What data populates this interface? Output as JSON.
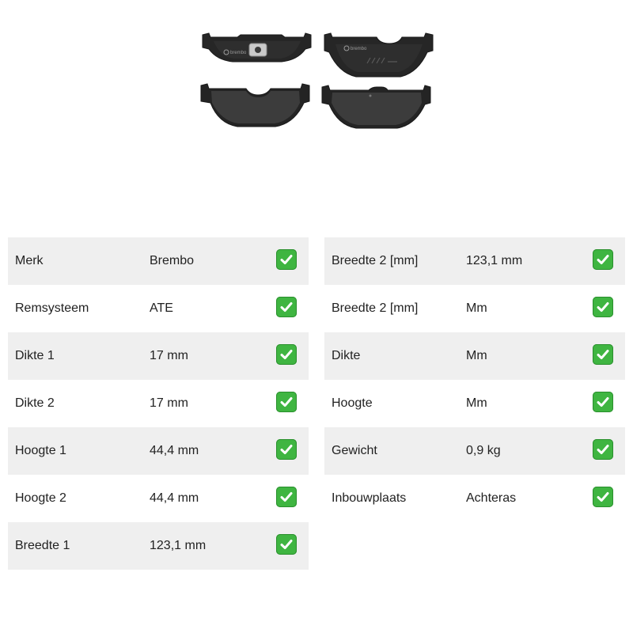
{
  "product_image": {
    "logo_text": "brembo"
  },
  "colors": {
    "row_alt": "#efefef",
    "text": "#222222",
    "check_green": "#3fb541",
    "pad_plate": "#262626",
    "pad_friction": "#3c3c3c"
  },
  "icons": {
    "status": "check-icon"
  },
  "specs_left": [
    {
      "label": "Merk",
      "value": "Brembo",
      "checked": true
    },
    {
      "label": "Remsysteem",
      "value": "ATE",
      "checked": true
    },
    {
      "label": "Dikte 1",
      "value": "17 mm",
      "checked": true
    },
    {
      "label": "Dikte 2",
      "value": "17 mm",
      "checked": true
    },
    {
      "label": "Hoogte 1",
      "value": "44,4 mm",
      "checked": true
    },
    {
      "label": "Hoogte 2",
      "value": "44,4 mm",
      "checked": true
    },
    {
      "label": "Breedte 1",
      "value": "123,1 mm",
      "checked": true
    }
  ],
  "specs_right": [
    {
      "label": "Breedte 2 [mm]",
      "value": "123,1 mm",
      "checked": true
    },
    {
      "label": "Breedte 2 [mm]",
      "value": "Mm",
      "checked": true
    },
    {
      "label": "Dikte",
      "value": "Mm",
      "checked": true
    },
    {
      "label": "Hoogte",
      "value": "Mm",
      "checked": true
    },
    {
      "label": "Gewicht",
      "value": "0,9 kg",
      "checked": true
    },
    {
      "label": "Inbouwplaats",
      "value": "Achteras",
      "checked": true
    }
  ]
}
